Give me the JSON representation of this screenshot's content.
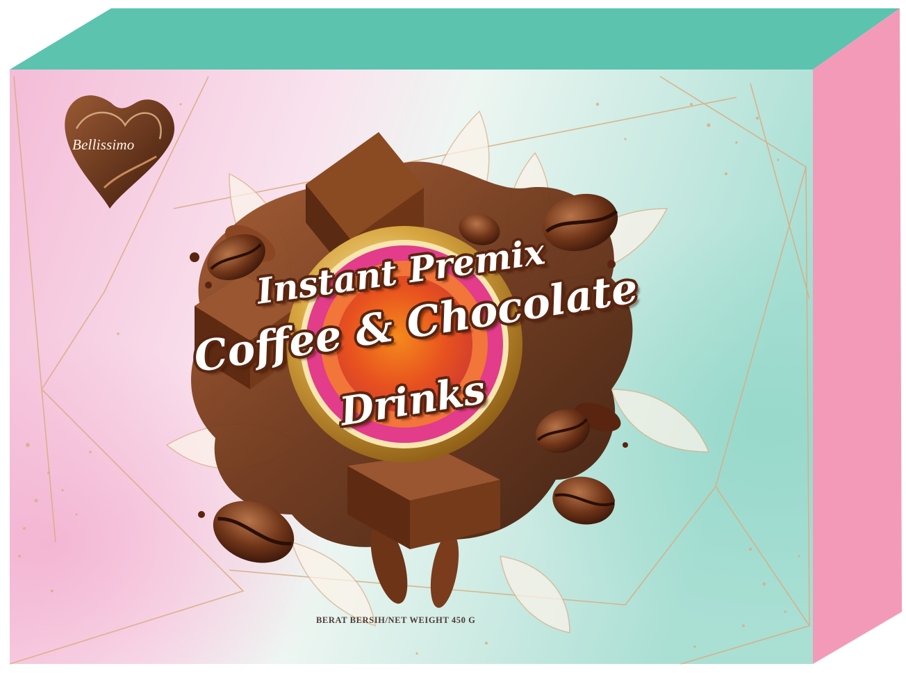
{
  "brand": {
    "name": "Bellissimo"
  },
  "product": {
    "title_line_1": "Instant Premix",
    "title_line_2": "Coffee & Chocolate",
    "title_line_3": "Drinks"
  },
  "net_weight": "BERAT BERSIH/NET WEIGHT 450 G",
  "colors": {
    "box_top": "#5cc3ae",
    "box_side": "#f39ab9",
    "front_pink": "#f4bdd7",
    "front_mint": "#bfe6dd",
    "gold": "#d9ae84",
    "chocolate": "#6b3418"
  },
  "icons": [
    "heart-logo-icon",
    "coffee-bean-icon",
    "chocolate-chunk-icon",
    "medallion-icon"
  ]
}
